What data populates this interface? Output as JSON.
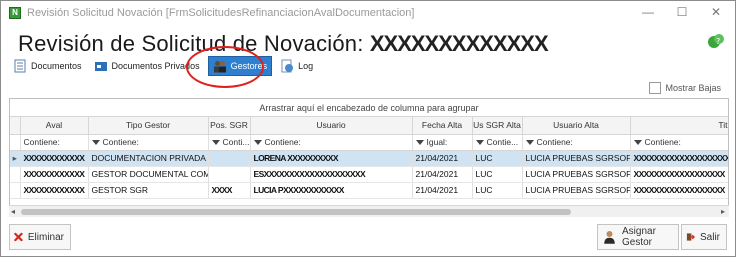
{
  "window": {
    "title": "Revisión Solicitud Novación [FrmSolicitudesRefinanciacionAvalDocumentacion]",
    "app_icon_label": "N",
    "controls": {
      "minimize": "—",
      "maximize": "☐",
      "close": "✕"
    }
  },
  "header": {
    "title": "Revisión de Solicitud de Novación:",
    "redacted_id": "XXXXXXXXXXXXX"
  },
  "tabs": [
    {
      "label": "Documentos",
      "icon": "document-icon",
      "active": false
    },
    {
      "label": "Documentos Privados",
      "icon": "private-documents-icon",
      "active": false
    },
    {
      "label": "Gestores",
      "icon": "users-icon",
      "active": true
    },
    {
      "label": "Log",
      "icon": "log-icon",
      "active": false
    }
  ],
  "mostrar_bajas": {
    "label": "Mostrar Bajas",
    "checked": false
  },
  "grid": {
    "group_panel_text": "Arrastrar aquí el encabezado de columna para agrupar",
    "columns": [
      "Aval",
      "Tipo Gestor",
      "Pos. SGR",
      "Usuario",
      "Fecha Alta",
      "Us SGR Alta",
      "Usuario Alta",
      "Titular"
    ],
    "filters": [
      "Contiene:",
      "Contiene:",
      "Conti...",
      "Contiene:",
      "Igual:",
      "Contie...",
      "Contiene:",
      "Contiene:"
    ],
    "rows": [
      {
        "aval": "XXXXXXXXXXXX",
        "tipo_gestor": "DOCUMENTACION PRIVADA",
        "pos_sgr": "",
        "usuario": "LORENA XXXXXXXXXX",
        "fecha_alta": "21/04/2021",
        "us_sgr_alta": "LUC",
        "usuario_alta": "LUCIA PRUEBAS SGRSOFT",
        "titular": "XXXXXXXXXXXXXXXXXXX"
      },
      {
        "aval": "XXXXXXXXXXXX",
        "tipo_gestor": "GESTOR DOCUMENTAL COMP...",
        "pos_sgr": "",
        "usuario": "ESXXXXXXXXXXXXXXXXXXXX",
        "fecha_alta": "21/04/2021",
        "us_sgr_alta": "LUC",
        "usuario_alta": "LUCIA PRUEBAS SGRSOFT",
        "titular": "XXXXXXXXXXXXXXXXXX"
      },
      {
        "aval": "XXXXXXXXXXXX",
        "tipo_gestor": "GESTOR SGR",
        "pos_sgr": "XXXX",
        "usuario": "LUCIA PXXXXXXXXXXXX",
        "fecha_alta": "21/04/2021",
        "us_sgr_alta": "LUC",
        "usuario_alta": "LUCIA PRUEBAS SGRSOFT",
        "titular": "XXXXXXXXXXXXXXXXXX"
      }
    ]
  },
  "footer": {
    "eliminar": "Eliminar",
    "asignar": "Asignar Gestor",
    "salir": "Salir"
  },
  "colors": {
    "active_tab": "#2e7fcf",
    "selected_row": "#cfe3f3",
    "highlight_ring": "#e0201c"
  }
}
